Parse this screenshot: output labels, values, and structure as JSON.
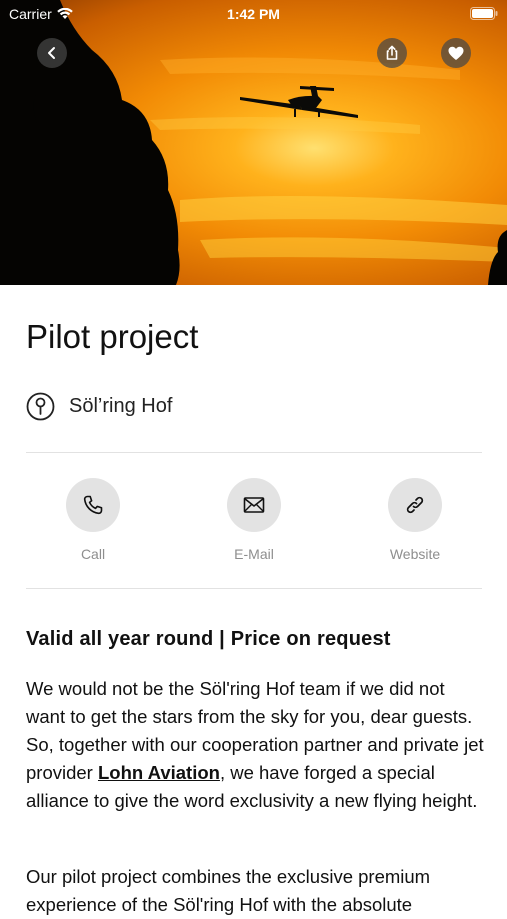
{
  "status_bar": {
    "carrier": "Carrier",
    "time": "1:42 PM"
  },
  "icons": {
    "back": "chevron-left-icon",
    "share": "share-icon",
    "favorite": "heart-icon",
    "location": "pin-icon",
    "call": "phone-icon",
    "email": "envelope-icon",
    "website": "link-icon"
  },
  "page": {
    "title": "Pilot project",
    "location": "Söl’ring Hof"
  },
  "actions": {
    "call": "Call",
    "email": "E-Mail",
    "website": "Website"
  },
  "content": {
    "headline": "Valid all year round | Price on request",
    "p1_part1": "We would not be the Söl'ring Hof team if we did not want to get the stars from the sky for you, dear guests. So, together with our cooperation partner and private jet provider ",
    "p1_link": "Lohn Aviation",
    "p1_part2": ", we have forged a special alliance to give the word exclusivity a new flying height.",
    "p2": "Our pilot project combines the exclusive premium experience of the Söl'ring Hof with the absolute"
  },
  "colors": {
    "sky_center": "#ffe070",
    "sky_edge": "#c95e00",
    "button_bg": "#e3e3e3",
    "label": "#8e8e8e"
  }
}
